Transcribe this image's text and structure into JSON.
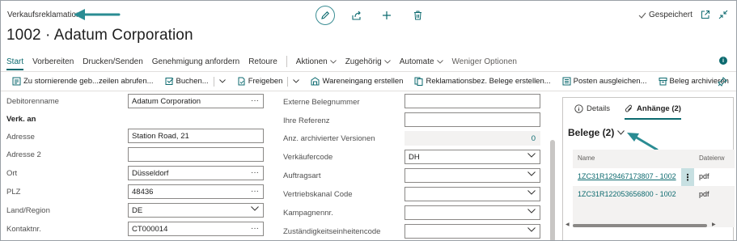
{
  "header": {
    "page_type": "Verkaufsreklamation",
    "title": "1002 · Adatum Corporation",
    "saved_label": "Gespeichert"
  },
  "menu": {
    "items": [
      {
        "label": "Start",
        "active": true
      },
      {
        "label": "Vorbereiten"
      },
      {
        "label": "Drucken/Senden"
      },
      {
        "label": "Genehmigung anfordern"
      },
      {
        "label": "Retoure"
      }
    ],
    "dropdowns": [
      {
        "label": "Aktionen"
      },
      {
        "label": "Zugehörig"
      },
      {
        "label": "Automate"
      }
    ],
    "fewer_options": "Weniger Optionen"
  },
  "actions": [
    {
      "label": "Zu stornierende geb...zeilen abrufen..."
    },
    {
      "label": "Buchen..."
    },
    {
      "label": "Freigeben"
    },
    {
      "label": "Wareneingang erstellen"
    },
    {
      "label": "Reklamationsbez. Belege erstellen..."
    },
    {
      "label": "Posten ausgleichen..."
    },
    {
      "label": "Beleg archivieren"
    }
  ],
  "left_fields": {
    "debitorenname": {
      "label": "Debitorenname",
      "value": "Adatum Corporation"
    },
    "section_verk_an": "Verk. an",
    "adresse": {
      "label": "Adresse",
      "value": "Station Road, 21"
    },
    "adresse2": {
      "label": "Adresse 2",
      "value": ""
    },
    "ort": {
      "label": "Ort",
      "value": "Düsseldorf"
    },
    "plz": {
      "label": "PLZ",
      "value": "48436"
    },
    "land_region": {
      "label": "Land/Region",
      "value": "DE"
    },
    "kontaktnr": {
      "label": "Kontaktnr.",
      "value": "CT000014"
    }
  },
  "right_fields": {
    "externe_belegnummer": {
      "label": "Externe Belegnummer",
      "value": ""
    },
    "ihre_referenz": {
      "label": "Ihre Referenz",
      "value": ""
    },
    "anz_archivierter": {
      "label": "Anz. archivierter Versionen",
      "value": "0"
    },
    "verkaeufercode": {
      "label": "Verkäufercode",
      "value": "DH"
    },
    "auftragsart": {
      "label": "Auftragsart",
      "value": ""
    },
    "vertriebskanal": {
      "label": "Vertriebskanal Code",
      "value": ""
    },
    "kampagnennr": {
      "label": "Kampagnennr.",
      "value": ""
    },
    "zustaendigkeit": {
      "label": "Zuständigkeitseinheitencode",
      "value": ""
    }
  },
  "factbox": {
    "tabs": [
      {
        "label": "Details"
      },
      {
        "label": "Anhänge (2)",
        "active": true
      }
    ],
    "section_title": "Belege (2)",
    "columns": {
      "name": "Name",
      "ext": "Dateierw"
    },
    "rows": [
      {
        "name": "1ZC31R129467173807 - 1002",
        "ext": "pdf"
      },
      {
        "name": "1ZC31R122053656800 - 1002",
        "ext": "pdf"
      }
    ]
  },
  "colors": {
    "accent": "#0c6a6f",
    "arrow": "#2a8c93",
    "selected_cell": "#c7e0e2"
  }
}
